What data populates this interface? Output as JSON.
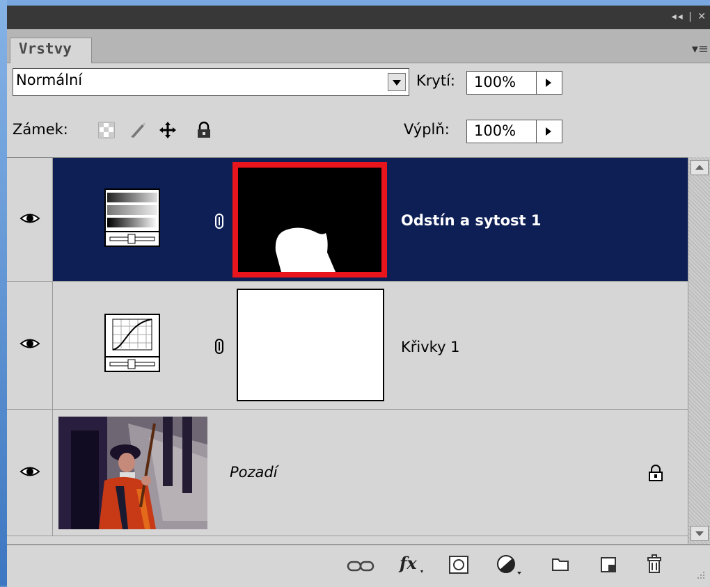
{
  "panel": {
    "tab_label": "Vrstvy",
    "controls": "◂◂ | ✕"
  },
  "blend_mode": {
    "value": "Normální"
  },
  "opacity": {
    "label": "Krytí:",
    "value": "100%"
  },
  "lock": {
    "label": "Zámek:"
  },
  "fill": {
    "label": "Výplň:",
    "value": "100%"
  },
  "layers": [
    {
      "name": "Odstín a sytost 1",
      "selected": true,
      "visible": true
    },
    {
      "name": "Křivky 1",
      "selected": false,
      "visible": true
    },
    {
      "name": "Pozadí",
      "selected": false,
      "visible": true,
      "locked": true
    }
  ],
  "colors": {
    "selection": "#0d1f55",
    "mask_border": "#e8151d",
    "panel_bg": "#d6d6d6"
  },
  "bottom_icons": [
    "link-layers-icon",
    "fx-icon",
    "add-mask-icon",
    "adjustment-layer-icon",
    "group-folder-icon",
    "new-layer-icon",
    "trash-icon"
  ]
}
